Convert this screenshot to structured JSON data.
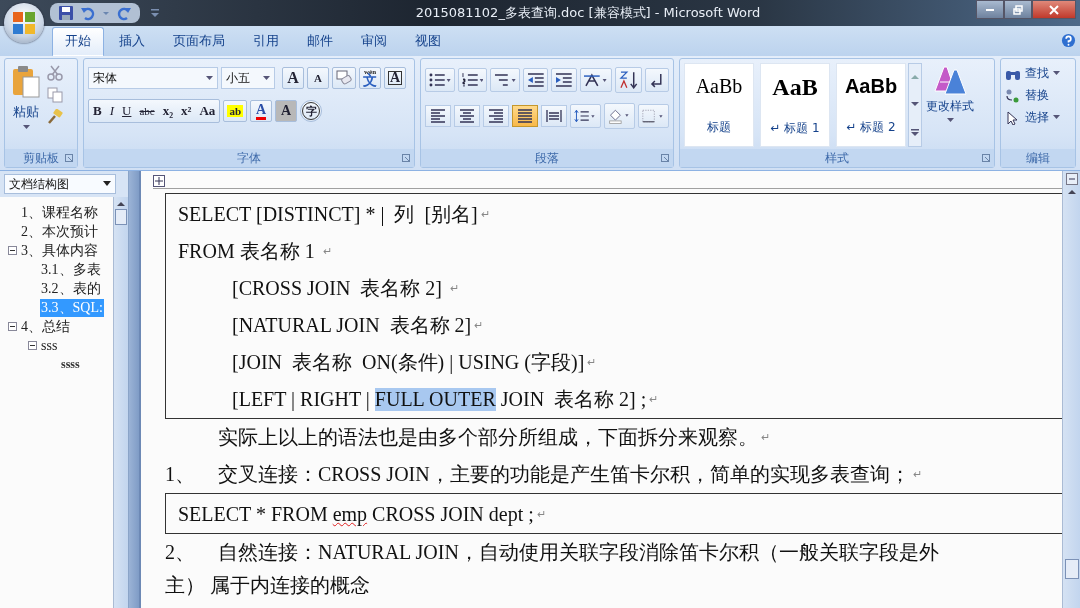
{
  "window": {
    "title": "2015081102_多表查询.doc [兼容模式] - Microsoft Word"
  },
  "tabs": [
    {
      "label": "开始",
      "selected": true
    },
    {
      "label": "插入",
      "selected": false
    },
    {
      "label": "页面布局",
      "selected": false
    },
    {
      "label": "引用",
      "selected": false
    },
    {
      "label": "邮件",
      "selected": false
    },
    {
      "label": "审阅",
      "selected": false
    },
    {
      "label": "视图",
      "selected": false
    }
  ],
  "ribbon": {
    "clipboard": {
      "paste": "粘贴",
      "title": "剪贴板"
    },
    "font": {
      "name": "宋体",
      "size": "小五",
      "title": "字体",
      "tools": [
        {
          "kind": "grow",
          "text": "A"
        },
        {
          "kind": "shrink",
          "text": "A"
        },
        {
          "kind": "clear"
        },
        {
          "kind": "phonetic",
          "ruby": "wén",
          "text": "文"
        },
        {
          "kind": "border",
          "text": "A"
        }
      ],
      "format_buttons": [
        {
          "kind": "bold",
          "text": "B"
        },
        {
          "kind": "italic",
          "text": "I"
        },
        {
          "kind": "underline",
          "text": "U"
        },
        {
          "kind": "strike",
          "text": "abc"
        },
        {
          "kind": "sub",
          "text": "x₂"
        },
        {
          "kind": "sup",
          "text": "x²"
        },
        {
          "kind": "case",
          "text": "Aa"
        }
      ],
      "color_tools": [
        {
          "kind": "highlight",
          "text": "ab"
        },
        {
          "kind": "color",
          "text": "A"
        },
        {
          "kind": "shading",
          "text": "A"
        },
        {
          "kind": "enclose",
          "text": "字"
        }
      ]
    },
    "paragraph": {
      "title": "段落",
      "alignments": [
        {
          "selected": false
        },
        {
          "selected": false
        },
        {
          "selected": false
        },
        {
          "selected": true
        },
        {
          "selected": false
        }
      ]
    },
    "styles": {
      "title": "样式",
      "change": "更改样式",
      "items": [
        {
          "preview": "AaBb",
          "name": "标题",
          "kind": "title"
        },
        {
          "preview": "AaB",
          "name": "↵ 标题 1",
          "kind": "h1"
        },
        {
          "preview": "AaBb",
          "name": "↵ 标题 2",
          "kind": "h2"
        }
      ]
    },
    "editing": {
      "title": "编辑",
      "items": [
        {
          "kind": "find",
          "label": "查找"
        },
        {
          "kind": "replace",
          "label": "替换"
        },
        {
          "kind": "select",
          "label": "选择"
        }
      ]
    }
  },
  "doc_map": {
    "title": "文档结构图",
    "items": [
      {
        "label": "1、课程名称",
        "selected": false
      },
      {
        "label": "2、本次预计",
        "selected": false
      },
      {
        "label": "3、具体内容",
        "selected": false,
        "expanded": true,
        "children": [
          {
            "label": "3.1、多表",
            "selected": false
          },
          {
            "label": "3.2、表的",
            "selected": false
          },
          {
            "label": "3.3、SQL:",
            "selected": true
          }
        ]
      },
      {
        "label": "4、总结",
        "selected": false,
        "expanded": true,
        "children": [
          {
            "label": "sss",
            "selected": false,
            "expanded": true,
            "children": [
              {
                "label": "ssss",
                "selected": false
              }
            ]
          }
        ]
      }
    ]
  },
  "document": {
    "blocks": [
      {
        "kind": "code",
        "lines": [
          {
            "kind": "plain",
            "mark": "↵",
            "segments": [
              {
                "text": "SELECT [DISTINCT] * |  列  [别名]",
                "selected": false,
                "misspelled": false
              }
            ]
          },
          {
            "kind": "plain",
            "mark": "↵",
            "segments": [
              {
                "text": "FROM 表名称 1 ",
                "selected": false,
                "misspelled": false
              }
            ]
          },
          {
            "kind": "indented",
            "mark": "↵",
            "segments": [
              {
                "text": "[CROSS JOIN  表名称 2] ",
                "selected": false,
                "misspelled": false
              }
            ]
          },
          {
            "kind": "indented",
            "mark": "↵",
            "segments": [
              {
                "text": "[NATURAL JOIN  表名称 2]",
                "selected": false,
                "misspelled": false
              }
            ]
          },
          {
            "kind": "indented",
            "mark": "↵",
            "segments": [
              {
                "text": "[JOIN  表名称  ON(条件) | USING (字段)]",
                "selected": false,
                "misspelled": false
              }
            ]
          },
          {
            "kind": "indented",
            "mark": "↵",
            "segments": [
              {
                "text": "[LEFT | RIGHT | ",
                "selected": false,
                "misspelled": false
              },
              {
                "text": "FULL OUTER",
                "selected": true,
                "misspelled": false
              },
              {
                "text": " JOIN  表名称 2] ;",
                "selected": false,
                "misspelled": false
              }
            ]
          }
        ]
      },
      {
        "kind": "paragraph",
        "text": "实际上以上的语法也是由多个部分所组成，下面拆分来观察。",
        "mark": "↵"
      },
      {
        "kind": "numbered",
        "number": "1、",
        "text": "交叉连接：CROSS JOIN，主要的功能是产生笛卡尔积，简单的实现多表查询；",
        "mark": "↵"
      },
      {
        "kind": "code",
        "lines": [
          {
            "kind": "plain",
            "mark": "↵",
            "segments": [
              {
                "text": "SELECT * FROM ",
                "selected": false,
                "misspelled": false
              },
              {
                "text": "emp",
                "selected": false,
                "misspelled": true
              },
              {
                "text": " CROSS JOIN dept ;",
                "selected": false,
                "misspelled": false
              }
            ]
          }
        ]
      },
      {
        "kind": "numbered",
        "number": "2、",
        "text": "自然连接：NATURAL  JOIN，自动使用关联字段消除笛卡尔积（一般关联字段是外"
      },
      {
        "kind": "continuation",
        "text": "主）  属于内连接的概念"
      }
    ]
  }
}
